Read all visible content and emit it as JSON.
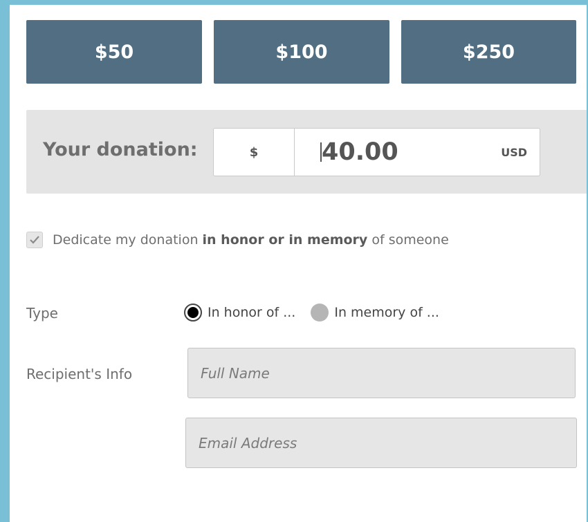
{
  "amount_buttons": [
    "$50",
    "$100",
    "$250"
  ],
  "donation": {
    "label": "Your donation:",
    "currency_symbol": "$",
    "value": "40.00",
    "currency_code": "USD"
  },
  "dedicate": {
    "checked": true,
    "text_before": "Dedicate my donation ",
    "text_bold": "in honor or in memory",
    "text_after": " of someone"
  },
  "type": {
    "label": "Type",
    "options": [
      "In honor of ...",
      "In memory of ..."
    ],
    "selected_index": 0
  },
  "recipient": {
    "label": "Recipient's Info",
    "full_name_placeholder": "Full Name",
    "email_placeholder": "Email Address"
  },
  "colors": {
    "button_bg": "#526e82",
    "frame_bg": "#79bfd6",
    "donation_box_bg": "#e4e4e4"
  }
}
